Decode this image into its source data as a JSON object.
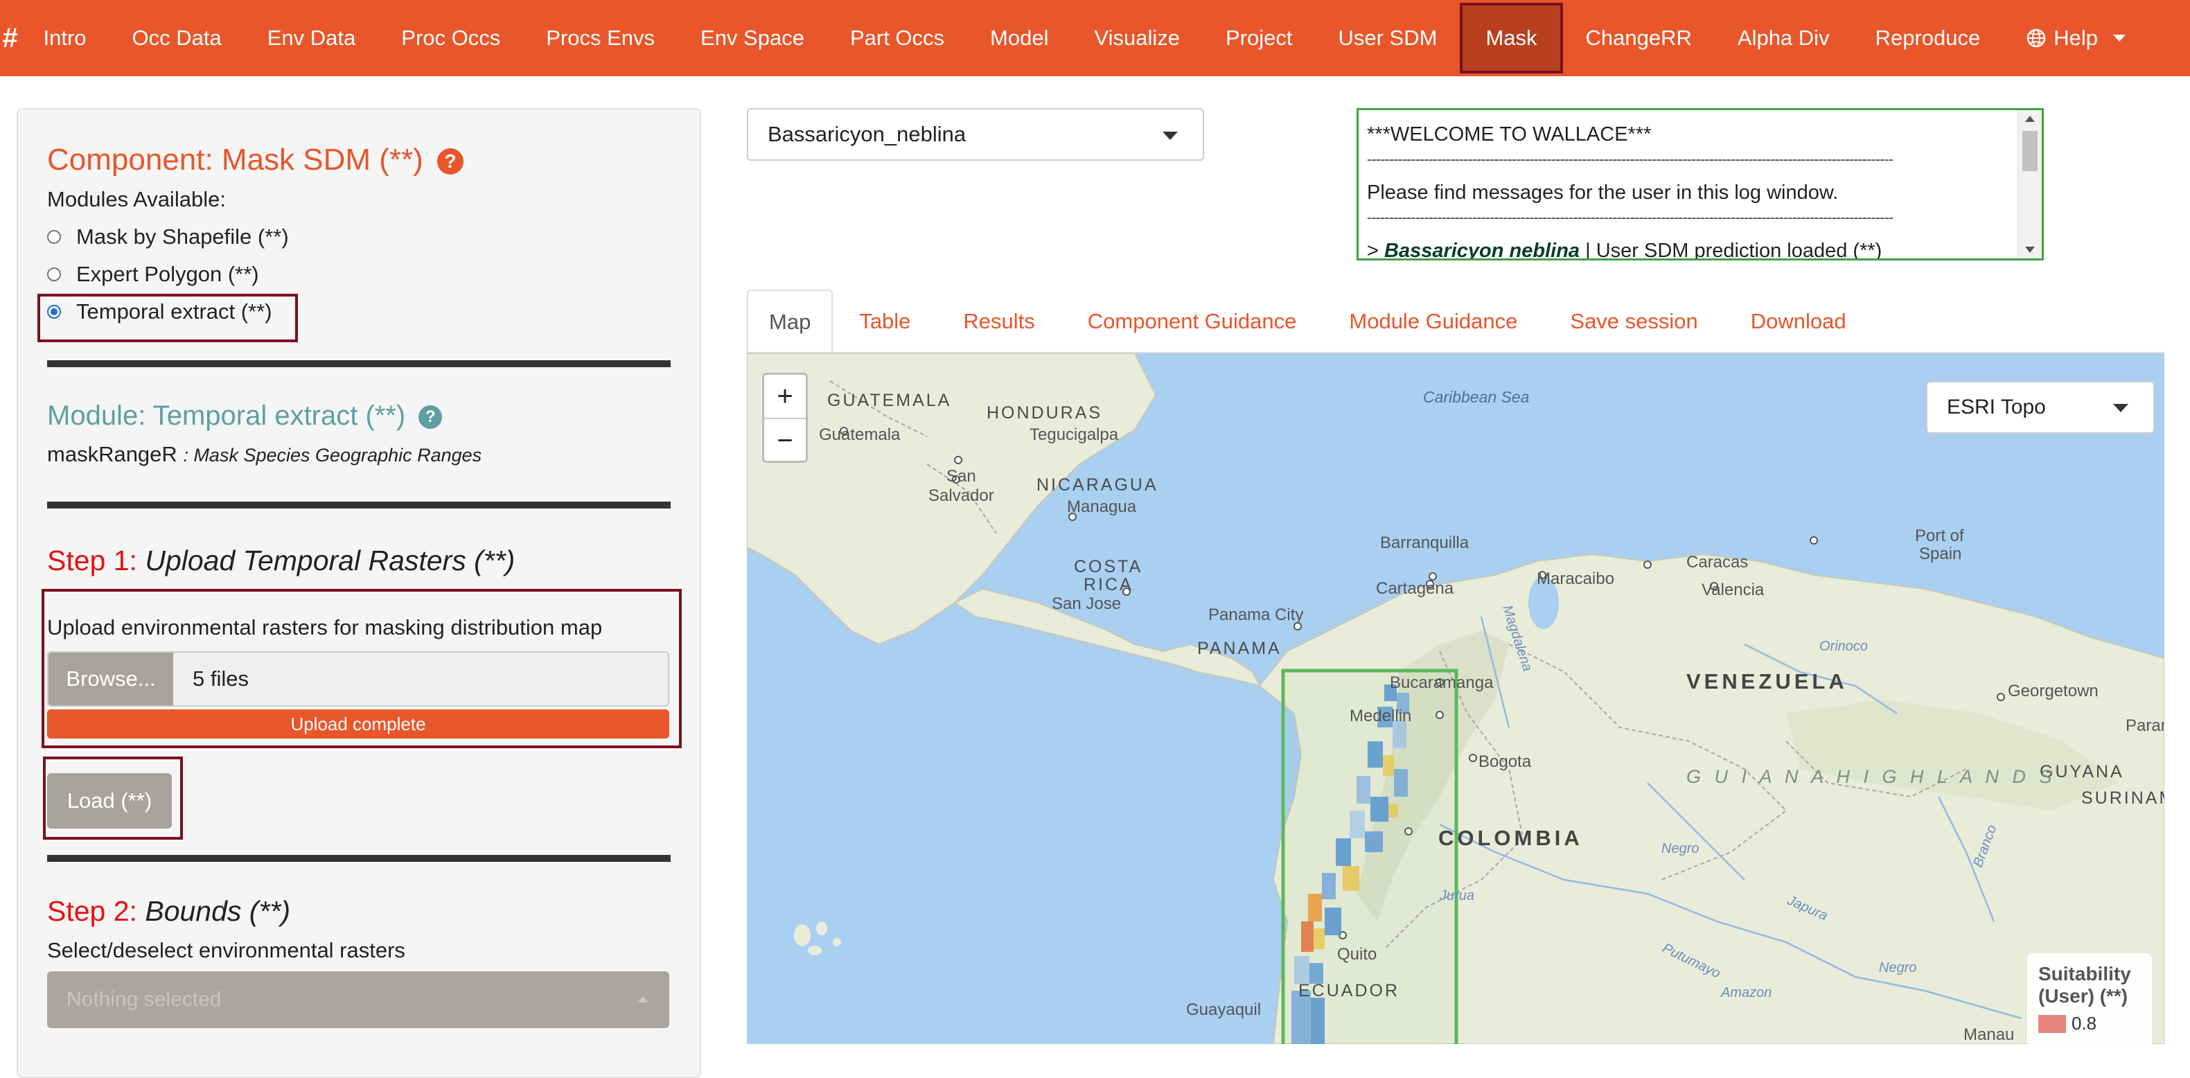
{
  "navbar": {
    "brand": "#",
    "items": [
      "Intro",
      "Occ Data",
      "Env Data",
      "Proc Occs",
      "Procs Envs",
      "Env Space",
      "Part Occs",
      "Model",
      "Visualize",
      "Project",
      "User SDM",
      "Mask",
      "ChangeRR",
      "Alpha Div",
      "Reproduce"
    ],
    "active": "Mask",
    "help": "Help"
  },
  "left": {
    "component_title": "Component: Mask SDM (**)",
    "modules_label": "Modules Available:",
    "modules": [
      "Mask by Shapefile (**)",
      "Expert Polygon (**)",
      "Temporal extract (**)"
    ],
    "selected_module": "Temporal extract (**)",
    "module_title": "Module: Temporal extract (**)",
    "module_fn": "maskRangeR",
    "module_fn_desc": ": Mask Species Geographic Ranges",
    "step1_num": "Step 1:",
    "step1_text": "Upload Temporal Rasters (**)",
    "upload_label": "Upload environmental rasters for masking distribution map",
    "browse": "Browse...",
    "files": "5 files",
    "progress": "Upload complete",
    "load": "Load (**)",
    "step2_num": "Step 2:",
    "step2_text": "Bounds (**)",
    "select_label": "Select/deselect environmental rasters",
    "select_placeholder": "Nothing selected"
  },
  "species_select": "Bassaricyon_neblina",
  "log": {
    "line1": "***WELCOME TO WALLACE***",
    "separator": "------------------------------------------------------------------------------------------------------------------------",
    "line2": "Please find messages for the user in this log window.",
    "line3_prefix": "> ",
    "line3_species": "Bassaricyon neblina",
    "line3_rest": " | User SDM prediction loaded (**)"
  },
  "tabs": [
    "Map",
    "Table",
    "Results",
    "Component Guidance",
    "Module Guidance",
    "Save session",
    "Download"
  ],
  "active_tab": "Map",
  "map": {
    "zoom_in": "+",
    "zoom_out": "−",
    "basemap": "ESRI Topo",
    "labels": {
      "guatemala": "GUATEMALA",
      "honduras": "HONDURAS",
      "tegucigalpa": "Tegucigalpa",
      "guatemala_city": "Guatemala",
      "san": "San",
      "salvador": "Salvador",
      "nicaragua": "NICARAGUA",
      "managua": "Managua",
      "costa": "COSTA",
      "rica": "RICA",
      "san_jose": "San Jose",
      "panama_city": "Panama City",
      "panama": "PANAMA",
      "caribbean": "Caribbean Sea",
      "barranquilla": "Barranquilla",
      "cartagena": "Cartagena",
      "maracaibo": "Maracaibo",
      "caracas": "Caracas",
      "valencia": "Valencia",
      "port_of": "Port of",
      "spain": "Spain",
      "venezuela": "VENEZUELA",
      "bucaramanga": "Bucaramanga",
      "medellin": "Medellin",
      "bogota": "Bogota",
      "colombia": "COLOMBIA",
      "georgetown": "Georgetown",
      "guyana": "GUYANA",
      "guiana_highlands": "G U I A N A   H I G H L A N D S",
      "suriname": "SURINAME",
      "paramaribo": "Param",
      "quito": "Quito",
      "ecuador": "ECUADOR",
      "guayaquil": "Guayaquil",
      "manaus": "Manau",
      "orinoco": "Orinoco",
      "magdalena": "Magdalena",
      "negro": "Negro",
      "negro2": "Negro",
      "japura": "Japura",
      "putumayo": "Putumayo",
      "amazon": "Amazon",
      "branco": "Branco",
      "jurua": "Jurua"
    },
    "legend_title": "Suitability (User) (**)",
    "legend_value": "0.8"
  },
  "colors": {
    "accent": "#e8562a",
    "active_nav": "#b8401f",
    "highlight_border": "#7a1020",
    "teal": "#5d9fa2",
    "log_border": "#3fa33f",
    "mask_box": "#5cb85c"
  }
}
